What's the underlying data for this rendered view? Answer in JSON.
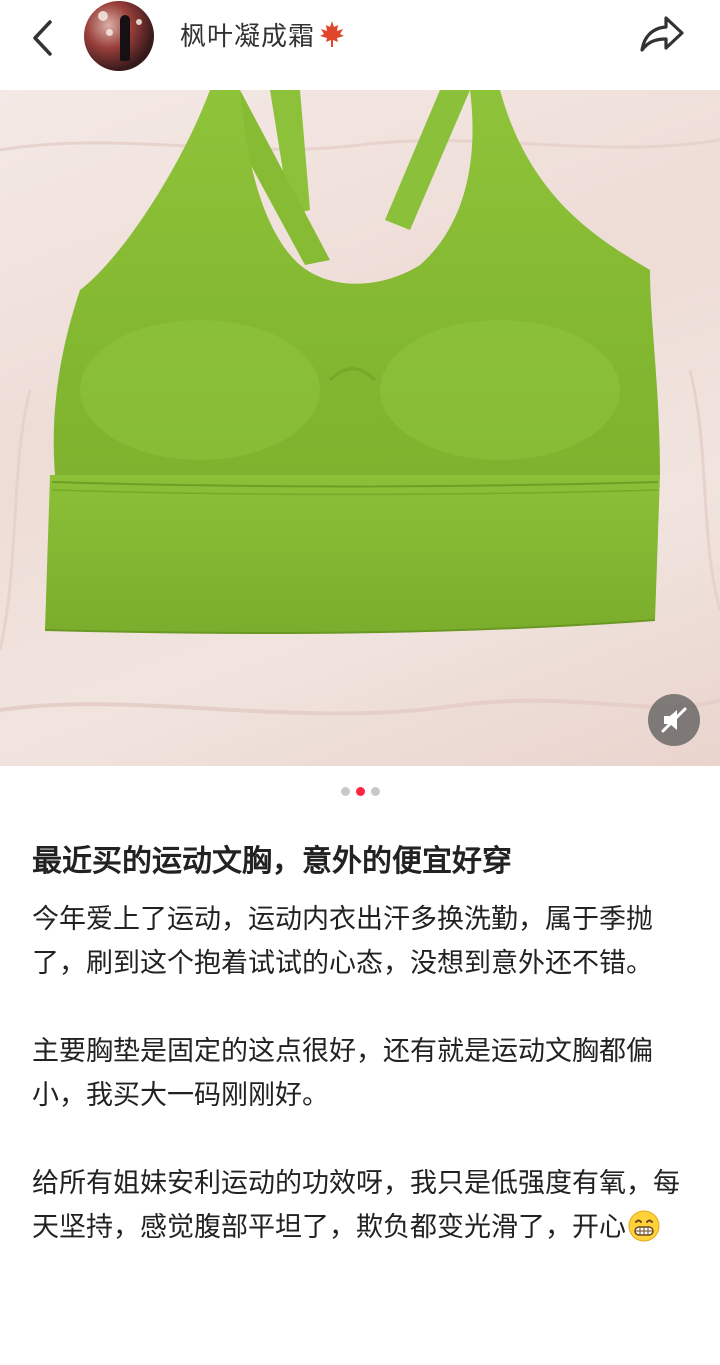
{
  "header": {
    "back_icon": "chevron-left-icon",
    "author_name": "枫叶凝成霜",
    "name_emoji": "maple-leaf-icon",
    "share_icon": "share-arrow-icon"
  },
  "media": {
    "image_description_icon": "photo",
    "mute_icon": "muted-speaker-icon",
    "carousel_total": 3,
    "carousel_active_index": 2,
    "active_dot_color": "#ff2442"
  },
  "post": {
    "title": "最近买的运动文胸，意外的便宜好穿",
    "paragraphs": [
      "今年爱上了运动，运动内衣出汗多换洗勤，属于季抛了，刷到这个抱着试试的心态，没想到意外还不错。",
      "主要胸垫是固定的这点很好，还有就是运动文胸都偏小，我买大一码刚刚好。",
      "给所有姐妹安利运动的功效呀，我只是低强度有氧，每天坚持，感觉腹部平坦了，欺负都变光滑了，开心"
    ],
    "trailing_emoji": "grinning-face-icon"
  }
}
